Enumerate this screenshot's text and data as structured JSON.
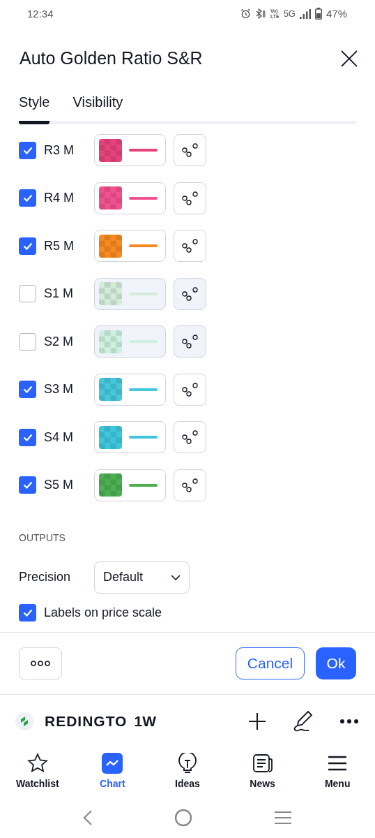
{
  "status_bar": {
    "time": "12:34",
    "volte": [
      "Vo)",
      "LTE"
    ],
    "network": "5G",
    "battery": "47%"
  },
  "dialog": {
    "title": "Auto Golden Ratio S&R",
    "tabs": [
      {
        "label": "Style",
        "selected": true
      },
      {
        "label": "Visibility",
        "selected": false
      }
    ],
    "levels": [
      {
        "label": "R3 M",
        "checked": true,
        "color": "#e8427a"
      },
      {
        "label": "R4 M",
        "checked": true,
        "color": "#f2518f"
      },
      {
        "label": "R5 M",
        "checked": true,
        "color": "#f7891f"
      },
      {
        "label": "S1 M",
        "checked": false,
        "color": "#d3ecd8"
      },
      {
        "label": "S2 M",
        "checked": false,
        "color": "#cdf0df"
      },
      {
        "label": "S3 M",
        "checked": true,
        "color": "#45c7dc"
      },
      {
        "label": "S4 M",
        "checked": true,
        "color": "#3ec6dc"
      },
      {
        "label": "S5 M",
        "checked": true,
        "color": "#4caf50"
      }
    ],
    "outputs": {
      "heading": "OUTPUTS",
      "precision_label": "Precision",
      "precision_value": "Default",
      "labels_on_price_scale": {
        "label": "Labels on price scale",
        "checked": true
      }
    },
    "buttons": {
      "cancel": "Cancel",
      "ok": "Ok"
    }
  },
  "symbol_bar": {
    "symbol": "REDINGTO",
    "interval": "1W"
  },
  "bottom_nav": [
    {
      "label": "Watchlist",
      "kind": "star",
      "selected": false
    },
    {
      "label": "Chart",
      "kind": "chart",
      "selected": true
    },
    {
      "label": "Ideas",
      "kind": "bulb",
      "selected": false
    },
    {
      "label": "News",
      "kind": "news",
      "selected": false
    },
    {
      "label": "Menu",
      "kind": "menu",
      "selected": false
    }
  ]
}
